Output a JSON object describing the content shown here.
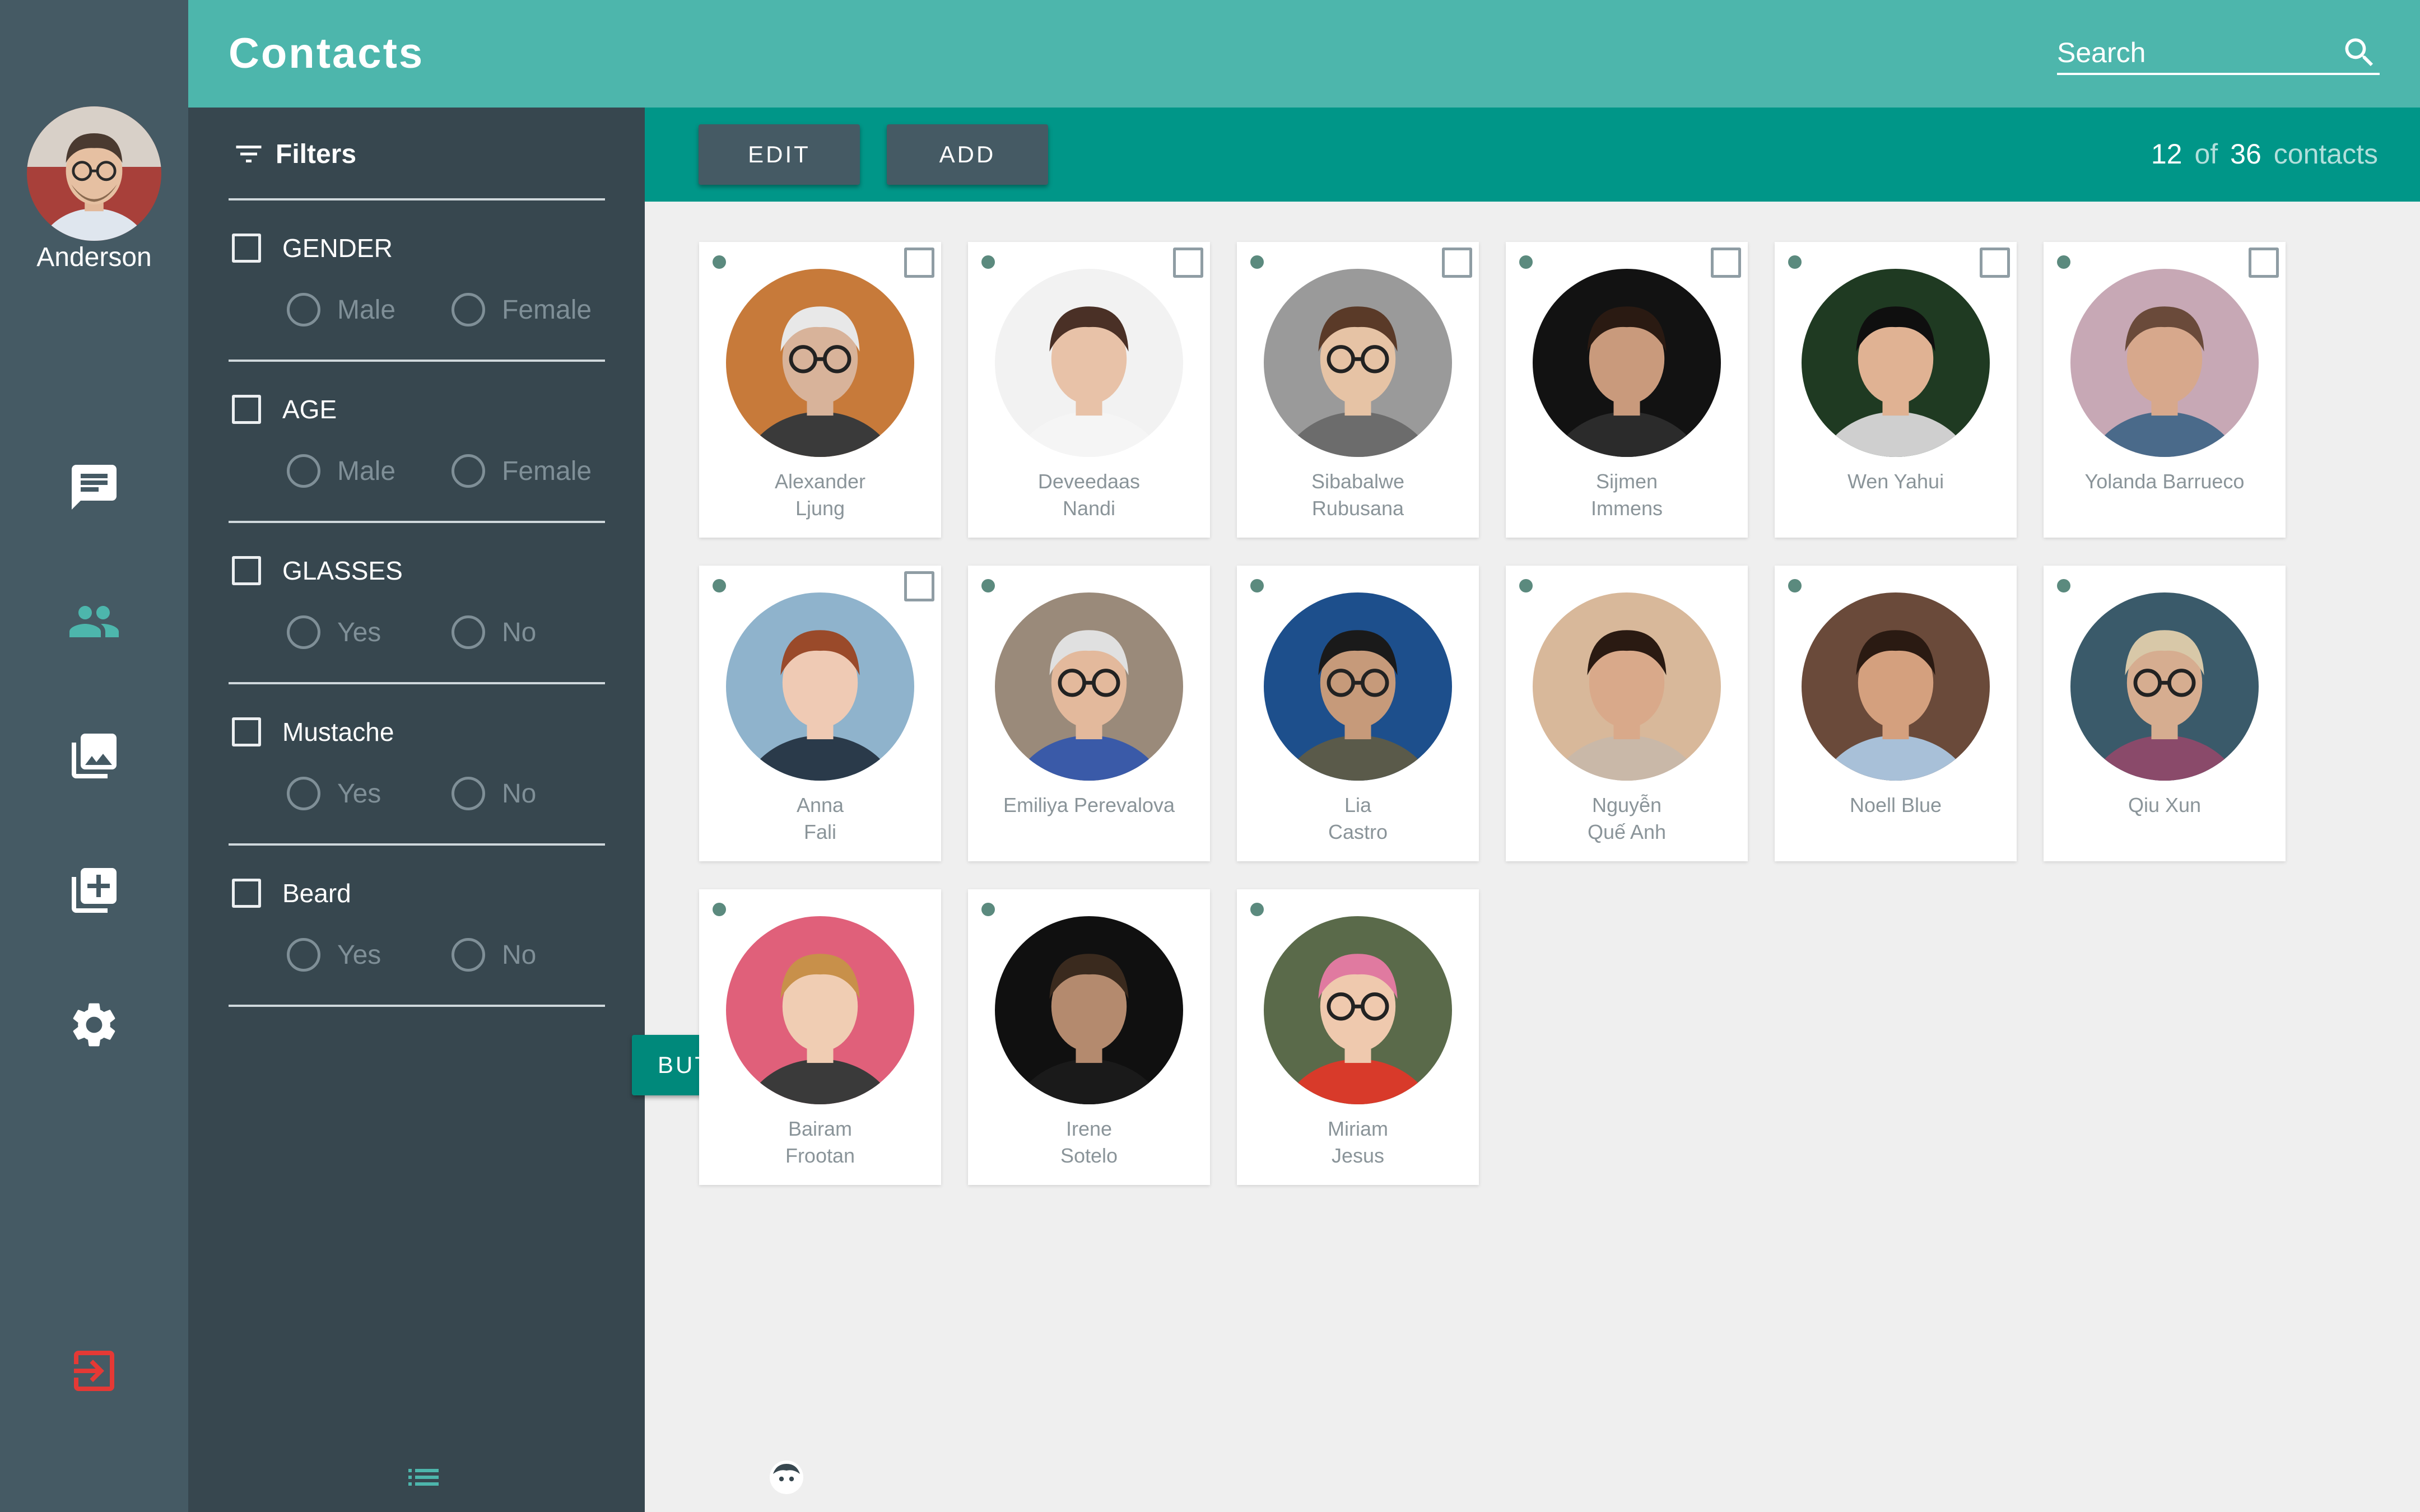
{
  "user": {
    "name": "Anderson"
  },
  "nav": {
    "items": [
      {
        "name": "chat-icon",
        "color": "#ffffff"
      },
      {
        "name": "people-icon",
        "color": "#4db6ac"
      },
      {
        "name": "photo-library-icon",
        "color": "#ffffff"
      },
      {
        "name": "add-to-queue-icon",
        "color": "#ffffff"
      },
      {
        "name": "settings-icon",
        "color": "#ffffff"
      }
    ],
    "logout": {
      "name": "logout-icon",
      "color": "#e53935"
    }
  },
  "header": {
    "title": "Contacts",
    "search_placeholder": "Search"
  },
  "toolbar": {
    "edit_label": "EDIT",
    "add_label": "ADD",
    "count_shown": "12",
    "count_of": "of",
    "count_total": "36",
    "count_unit": "contacts"
  },
  "filters": {
    "title": "Filters",
    "groups": [
      {
        "label": "GENDER",
        "options": [
          "Male",
          "Female"
        ]
      },
      {
        "label": "AGE",
        "options": [
          "Male",
          "Female"
        ]
      },
      {
        "label": "GLASSES",
        "options": [
          "Yes",
          "No"
        ]
      },
      {
        "label": "Mustache",
        "options": [
          "Yes",
          "No"
        ]
      },
      {
        "label": "Beard",
        "options": [
          "Yes",
          "No"
        ]
      }
    ],
    "button_label": "BUTTON"
  },
  "colors": {
    "rail": "#455a64",
    "panel": "#37474f",
    "header": "#4db6ac",
    "toolbar": "#009688",
    "accent": "#00897b",
    "logout": "#e53935"
  },
  "contacts": [
    {
      "name": "Alexander\nLjung",
      "has_checkbox": true,
      "bg": "#c77a3a",
      "skin": "#d8b39a",
      "hair": "#e8e8e8",
      "shirt": "#3a3a3a",
      "glasses": true
    },
    {
      "name": "Deveedaas\nNandi",
      "has_checkbox": true,
      "bg": "#f2f2f2",
      "skin": "#e8c2a8",
      "hair": "#4a3026",
      "shirt": "#f5f5f5",
      "glasses": false
    },
    {
      "name": "Sibabalwe\nRubusana",
      "has_checkbox": true,
      "bg": "#9a9a9a",
      "skin": "#e6c3a5",
      "hair": "#5a3a28",
      "shirt": "#6c6c6c",
      "glasses": true
    },
    {
      "name": "Sijmen\nImmens",
      "has_checkbox": true,
      "bg": "#121212",
      "skin": "#c99a7c",
      "hair": "#2a1a12",
      "shirt": "#2b2b2b",
      "glasses": false
    },
    {
      "name": "Wen Yahui",
      "has_checkbox": true,
      "bg": "#1f3a22",
      "skin": "#e0b293",
      "hair": "#0f0f0f",
      "shirt": "#cfcfcf",
      "glasses": false
    },
    {
      "name": "Yolanda Barrueco",
      "has_checkbox": true,
      "bg": "#c7a8b5",
      "skin": "#d7a88c",
      "hair": "#6a4a3a",
      "shirt": "#4a6a8a",
      "glasses": false
    },
    {
      "name": "Anna\nFali",
      "has_checkbox": true,
      "bg": "#8fb3cc",
      "skin": "#efcab4",
      "hair": "#9a4a2a",
      "shirt": "#2a3a4a",
      "glasses": false
    },
    {
      "name": "Emiliya Perevalova",
      "has_checkbox": false,
      "bg": "#9a8a7a",
      "skin": "#e3b99c",
      "hair": "#e0e0e0",
      "shirt": "#3a5aa8",
      "glasses": true
    },
    {
      "name": "Lia\nCastro",
      "has_checkbox": false,
      "bg": "#1d4f8c",
      "skin": "#c69a7a",
      "hair": "#1a1a1a",
      "shirt": "#5a5a4a",
      "glasses": true
    },
    {
      "name": "Nguyễn\nQuế Anh",
      "has_checkbox": false,
      "bg": "#d8b89a",
      "skin": "#d9a98a",
      "hair": "#2a1a12",
      "shirt": "#c9b8a8",
      "glasses": false
    },
    {
      "name": "Noell Blue",
      "has_checkbox": false,
      "bg": "#6a4a3a",
      "skin": "#d4a07e",
      "hair": "#2a1a12",
      "shirt": "#a8c0d8",
      "glasses": false
    },
    {
      "name": "Qiu Xun",
      "has_checkbox": false,
      "bg": "#3a5a6a",
      "skin": "#d6ad90",
      "hair": "#d8c8a8",
      "shirt": "#8a4a6a",
      "glasses": true
    },
    {
      "name": "Bairam\nFrootan",
      "has_checkbox": false,
      "bg": "#e0607a",
      "skin": "#f0cdb3",
      "hair": "#c8904a",
      "shirt": "#3a3a3a",
      "glasses": false
    },
    {
      "name": "Irene\nSotelo",
      "has_checkbox": false,
      "bg": "#101010",
      "skin": "#b48a6e",
      "hair": "#3a2a1e",
      "shirt": "#1a1a1a",
      "glasses": false
    },
    {
      "name": "Miriam\nJesus",
      "has_checkbox": false,
      "bg": "#5a6a4a",
      "skin": "#efc9ae",
      "hair": "#e07aa0",
      "shirt": "#d83a2a",
      "glasses": true
    }
  ]
}
